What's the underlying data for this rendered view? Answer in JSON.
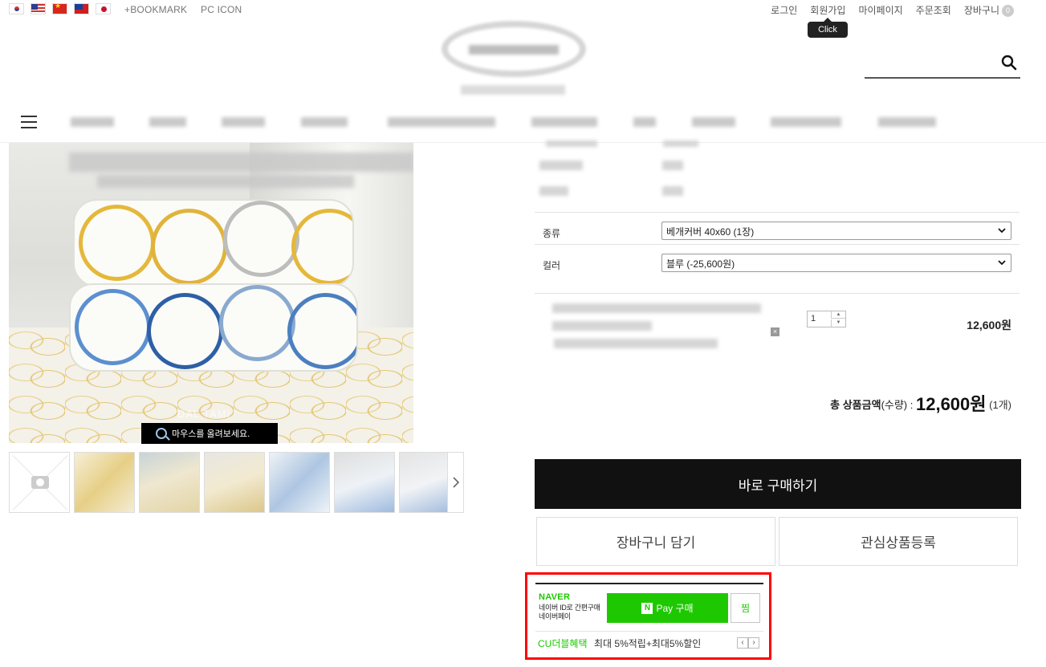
{
  "topbar": {
    "flags": [
      "korea-flag-icon",
      "usa-flag-icon",
      "china-flag-icon",
      "taiwan-flag-icon",
      "japan-flag-icon"
    ],
    "bookmark": "+BOOKMARK",
    "pc_icon": "PC ICON"
  },
  "usermenu": {
    "login": "로그인",
    "signup": "회원가입",
    "mypage": "마이페이지",
    "order_lookup": "주문조회",
    "cart": "장바구니",
    "cart_count": "0",
    "tooltip": "Click"
  },
  "search": {
    "icon": "search-icon"
  },
  "main_image": {
    "watermark": "DAL TAMI",
    "zoom_hint": "마우스를 올려보세요."
  },
  "options": {
    "type_label": "종류",
    "type_value": "베개커버 40x60 (1장)",
    "color_label": "컬러",
    "color_value": "블루 (-25,600원)"
  },
  "selected_item": {
    "quantity": "1",
    "remove": "×",
    "price": "12,600원"
  },
  "total": {
    "label": "총 상품금액",
    "qty_label": "(수량) : ",
    "amount": "12,600원",
    "count": "(1개)"
  },
  "buttons": {
    "buy_now": "바로 구매하기",
    "add_cart": "장바구니 담기",
    "wishlist": "관심상품등록"
  },
  "naverpay": {
    "logo": "NAVER",
    "desc_line1": "네이버 ID로 간편구매",
    "desc_line2": "네이버페이",
    "n_mark": "N",
    "buy_label": "Pay 구매",
    "wish": "찜",
    "cu_benefit": "CU더블혜택",
    "cu_text": "최대 5%적립+최대5%할인",
    "prev": "‹",
    "next": "›"
  },
  "colors": {
    "naver_green": "#1ec800",
    "highlight_red": "#ff0000",
    "buy_now_bg": "#111111"
  }
}
